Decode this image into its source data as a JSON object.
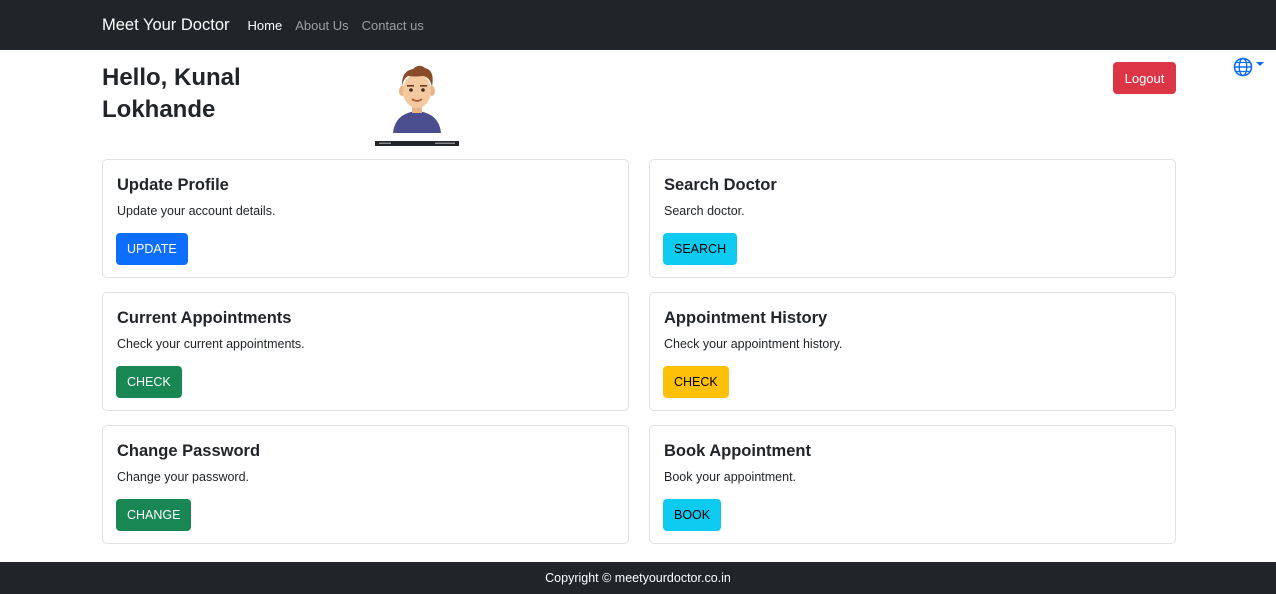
{
  "navbar": {
    "brand": "Meet Your Doctor",
    "links": [
      "Home",
      "About Us",
      "Contact us"
    ]
  },
  "header": {
    "greeting_line1": "Hello, Kunal",
    "greeting_line2": "Lokhande",
    "logout_label": "Logout",
    "language_icon": "globe-icon"
  },
  "cards": [
    {
      "title": "Update Profile",
      "text": "Update your account details.",
      "button": "UPDATE",
      "button_color": "#0d6efd"
    },
    {
      "title": "Search Doctor",
      "text": "Search doctor.",
      "button": "SEARCH",
      "button_color": "#0dcaf0"
    },
    {
      "title": "Current Appointments",
      "text": "Check your current appointments.",
      "button": "CHECK",
      "button_color": "#198754"
    },
    {
      "title": "Appointment History",
      "text": "Check your appointment history.",
      "button": "CHECK",
      "button_color": "#ffc107"
    },
    {
      "title": "Change Password",
      "text": "Change your password.",
      "button": "CHANGE",
      "button_color": "#198754"
    },
    {
      "title": "Book Appointment",
      "text": "Book your appointment.",
      "button": "BOOK",
      "button_color": "#0dcaf0"
    }
  ],
  "footer": {
    "copyright": "Copyright © meetyourdoctor.co.in"
  },
  "colors": {
    "navbar_bg": "#212529",
    "logout": "#dc3545",
    "globe": "#0d6efd"
  }
}
